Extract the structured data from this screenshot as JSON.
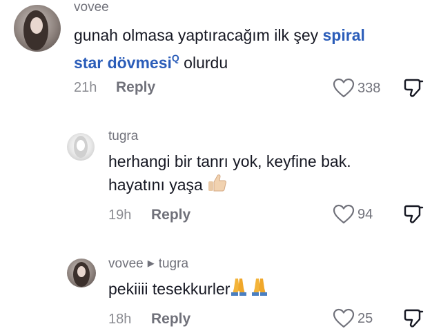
{
  "comments": [
    {
      "username": "vovee",
      "text_before": "gunah olmasa yaptıracağım ilk şey ",
      "link_part1": "spiral",
      "link_part2": "star dövmesi",
      "search_mark": "Q",
      "text_after": " olurdu",
      "time": "21h",
      "reply": "Reply",
      "likes": "338"
    },
    {
      "username": "tugra",
      "text_line1": "herhangi bir tanrı yok, keyfine bak.",
      "text_line2": "hayatını yaşa",
      "emoji": "thumbs-up",
      "time": "19h",
      "reply": "Reply",
      "likes": "94"
    },
    {
      "username": "vovee",
      "reply_to": "tugra",
      "text": "pekiiii tesekkurler",
      "emoji": "folded-hands",
      "time": "18h",
      "reply": "Reply",
      "likes": "25"
    }
  ]
}
